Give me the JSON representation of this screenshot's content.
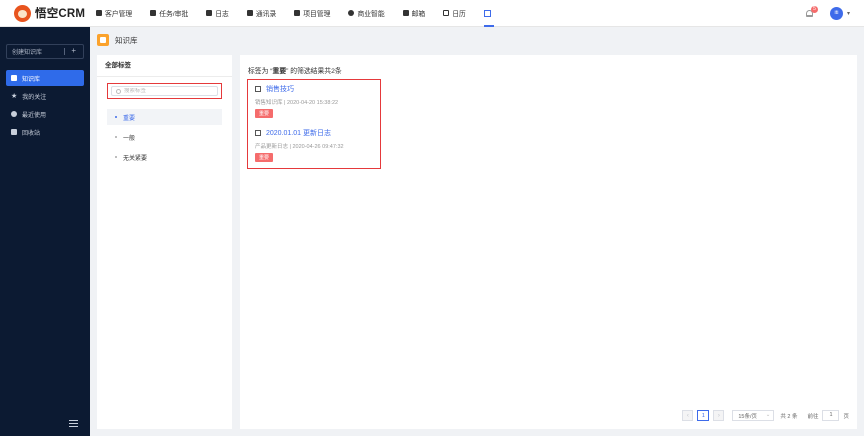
{
  "app": {
    "logo_text": "悟空CRM"
  },
  "nav": [
    {
      "label": "客户管理",
      "icon": "customer-icon"
    },
    {
      "label": "任务/审批",
      "icon": "task-icon"
    },
    {
      "label": "日志",
      "icon": "log-icon"
    },
    {
      "label": "通讯录",
      "icon": "contacts-icon"
    },
    {
      "label": "项目管理",
      "icon": "project-icon"
    },
    {
      "label": "商业智能",
      "icon": "bi-icon"
    },
    {
      "label": "邮箱",
      "icon": "mail-icon"
    },
    {
      "label": "日历",
      "icon": "calendar-icon"
    },
    {
      "label": "",
      "icon": "apps-grid-icon"
    }
  ],
  "header_right": {
    "notification_count": "5",
    "avatar_text": "iti"
  },
  "sidebar": {
    "create_label": "创建知识库",
    "items": [
      {
        "label": "知识库",
        "active": true
      },
      {
        "label": "我的关注",
        "active": false
      },
      {
        "label": "最近使用",
        "active": false
      },
      {
        "label": "回收站",
        "active": false
      }
    ]
  },
  "page": {
    "title": "知识库"
  },
  "tag_panel": {
    "heading": "全部标签",
    "search_placeholder": "搜索标签",
    "tags": [
      {
        "label": "重要",
        "active": true
      },
      {
        "label": "一般",
        "active": false
      },
      {
        "label": "无关紧要",
        "active": false
      }
    ]
  },
  "results": {
    "prefix": "标签为 “",
    "tag": "重要",
    "suffix": "” 的筛选结果共2条",
    "entries": [
      {
        "title": "销售技巧",
        "meta": "销售知识库 | 2020-04-20 15:38:22",
        "tag": "重要"
      },
      {
        "title": "2020.01.01 更新日志",
        "meta": "产品更新日志 | 2020-04-26 09:47:32",
        "tag": "重要"
      }
    ]
  },
  "pagination": {
    "prev": "‹",
    "current_page": "1",
    "next": "›",
    "page_size": "15条/页",
    "total": "共 2 条",
    "goto_label": "前往",
    "goto_value": "1",
    "page_unit": "页"
  }
}
